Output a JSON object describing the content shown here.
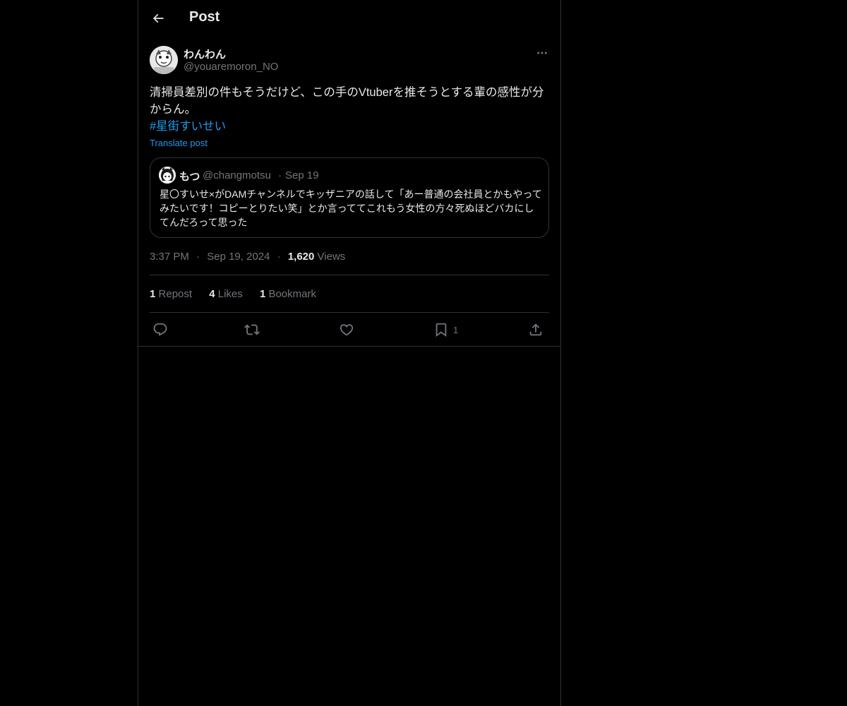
{
  "header": {
    "title": "Post"
  },
  "author": {
    "display_name": "わんわん",
    "handle": "@youaremoron_NO"
  },
  "post": {
    "text": "清掃員差別の件もそうだけど、この手のVtuberを推そうとする輩の感性が分からん。",
    "hashtag": "#星街すいせい",
    "translate_label": "Translate post"
  },
  "quote": {
    "display_name": "もつ",
    "handle": "@changmotsu",
    "separator": "·",
    "date": "Sep 19",
    "text": "星〇すいせ×がDAMチャンネルでキッザニアの話して「あー普通の会社員とかもやってみたいです！コピーとりたい笑」とか言っててこれもう女性の方々死ぬほどバカにしてんだろって思った"
  },
  "meta": {
    "time": "3:37 PM",
    "separator": "·",
    "date": "Sep 19, 2024",
    "views_count": "1,620",
    "views_label": "Views"
  },
  "stats": {
    "reposts_count": "1",
    "reposts_label": "Repost",
    "likes_count": "4",
    "likes_label": "Likes",
    "bookmarks_count": "1",
    "bookmarks_label": "Bookmark"
  },
  "actions": {
    "bookmark_count": "1"
  },
  "colors": {
    "background": "#000000",
    "text": "#e7e9ea",
    "muted": "#71767b",
    "accent": "#1d9bf0",
    "border": "#2f3336"
  },
  "icons": [
    "back-arrow-icon",
    "more-icon",
    "reply-icon",
    "repost-icon",
    "like-icon",
    "bookmark-icon",
    "share-icon"
  ]
}
